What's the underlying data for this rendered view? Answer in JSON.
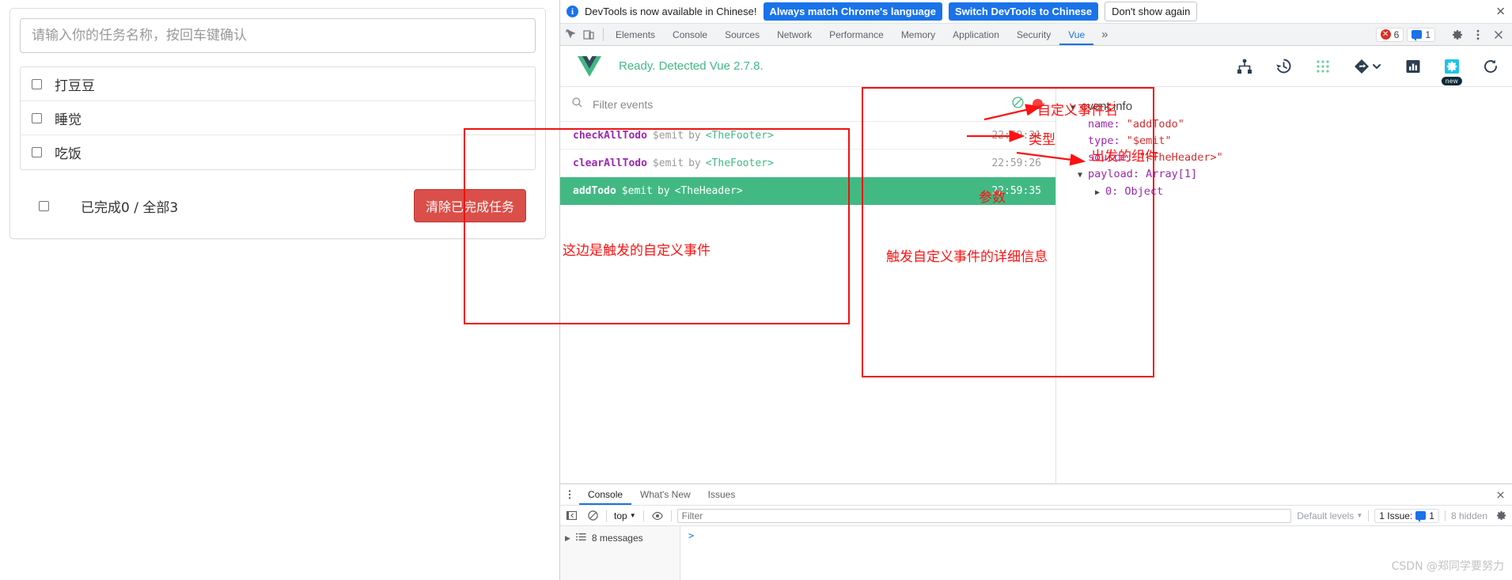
{
  "todo_app": {
    "input_placeholder": "请输入你的任务名称，按回车键确认",
    "input_value": "",
    "items": [
      {
        "label": "打豆豆",
        "checked": false
      },
      {
        "label": "睡觉",
        "checked": false
      },
      {
        "label": "吃饭",
        "checked": false
      }
    ],
    "footer": {
      "summary": "已完成0 / 全部3",
      "clear_button": "清除已完成任务",
      "check_all": false
    }
  },
  "devtools": {
    "infobar": {
      "message": "DevTools is now available in Chinese!",
      "info_icon": "info-icon",
      "btn_always_match": "Always match Chrome's language",
      "btn_switch": "Switch DevTools to Chinese",
      "btn_dont_show": "Don't show again",
      "close_icon": "close-icon"
    },
    "tabs": [
      {
        "label": "Elements",
        "active": false
      },
      {
        "label": "Console",
        "active": false
      },
      {
        "label": "Sources",
        "active": false
      },
      {
        "label": "Network",
        "active": false
      },
      {
        "label": "Performance",
        "active": false
      },
      {
        "label": "Memory",
        "active": false
      },
      {
        "label": "Application",
        "active": false
      },
      {
        "label": "Security",
        "active": false
      },
      {
        "label": "Vue",
        "active": true
      }
    ],
    "tab_overflow": "»",
    "errors_count": "6",
    "messages_count": "1",
    "icons": {
      "inspect": "inspect-element-icon",
      "device": "device-toolbar-icon",
      "settings": "gear-icon",
      "kebab": "more-options-icon",
      "close": "close-icon"
    }
  },
  "vue_panel": {
    "logo": "vue-logo-icon",
    "status": "Ready. Detected Vue 2.7.8.",
    "tools": [
      {
        "name": "components-tree-icon",
        "selected": false
      },
      {
        "name": "timeline-history-icon",
        "selected": false
      },
      {
        "name": "vuex-dots-icon",
        "selected": false
      },
      {
        "name": "routes-icon",
        "selected": false
      },
      {
        "name": "performance-bars-icon",
        "selected": false
      },
      {
        "name": "settings-gear-icon",
        "selected": true,
        "tag": "new"
      },
      {
        "name": "refresh-icon",
        "selected": false
      }
    ],
    "filter": {
      "placeholder": "Filter events",
      "value": "",
      "search_icon": "search-icon",
      "clear_icon": "ban-clear-icon",
      "record_icon": "record-dot-icon"
    },
    "events": [
      {
        "name": "checkAllTodo",
        "type": "$emit",
        "by": "by",
        "source": "<TheFooter>",
        "time": "22:59:21",
        "active": false
      },
      {
        "name": "clearAllTodo",
        "type": "$emit",
        "by": "by",
        "source": "<TheFooter>",
        "time": "22:59:26",
        "active": false
      },
      {
        "name": "addTodo",
        "type": "$emit",
        "by": "by",
        "source": "<TheHeader>",
        "time": "22:59:35",
        "active": true
      }
    ],
    "event_info": {
      "title": "event info",
      "rows": [
        {
          "key": "name:",
          "value": "\"addTodo\""
        },
        {
          "key": "type:",
          "value": "\"$emit\""
        },
        {
          "key": "source:",
          "value": "\"<TheHeader>\""
        }
      ],
      "payload_label": "payload: Array[1]",
      "payload_child": "0: Object"
    }
  },
  "annotations": {
    "event_name": "自定义事件名",
    "type": "类型",
    "source_component": "出发的组件",
    "params": "参数",
    "events_note": "这边是触发的自定义事件",
    "detail_note": "触发自定义事件的详细信息"
  },
  "drawer": {
    "tabs": [
      {
        "label": "Console",
        "active": true
      },
      {
        "label": "What's New",
        "active": false
      },
      {
        "label": "Issues",
        "active": false
      }
    ],
    "kebab_icon": "more-options-icon",
    "close_icon": "close-icon",
    "toolbar": {
      "sidebar_icon": "show-console-sidebar-icon",
      "clear_icon": "clear-console-icon",
      "context": "top",
      "context_caret": "chevron-down-icon",
      "eye_icon": "live-expression-icon",
      "filter_placeholder": "Filter",
      "filter_value": "",
      "levels": "Default levels",
      "levels_caret": "chevron-down-icon",
      "issues_label": "1 Issue:",
      "issues_count": "1",
      "hidden": "8 hidden",
      "settings_icon": "gear-icon"
    },
    "sidebar": {
      "messages": "8 messages",
      "expand_icon": "chevron-right-icon",
      "list_icon": "list-icon"
    },
    "prompt": ">"
  },
  "watermark": "CSDN @郑同学要努力",
  "colors": {
    "accent_blue": "#1a73e8",
    "vue_green": "#42b983",
    "annotation_red": "#ff1111",
    "danger": "#da4f49",
    "purple_key": "#9c27b0",
    "string_red": "#d32f2f"
  }
}
